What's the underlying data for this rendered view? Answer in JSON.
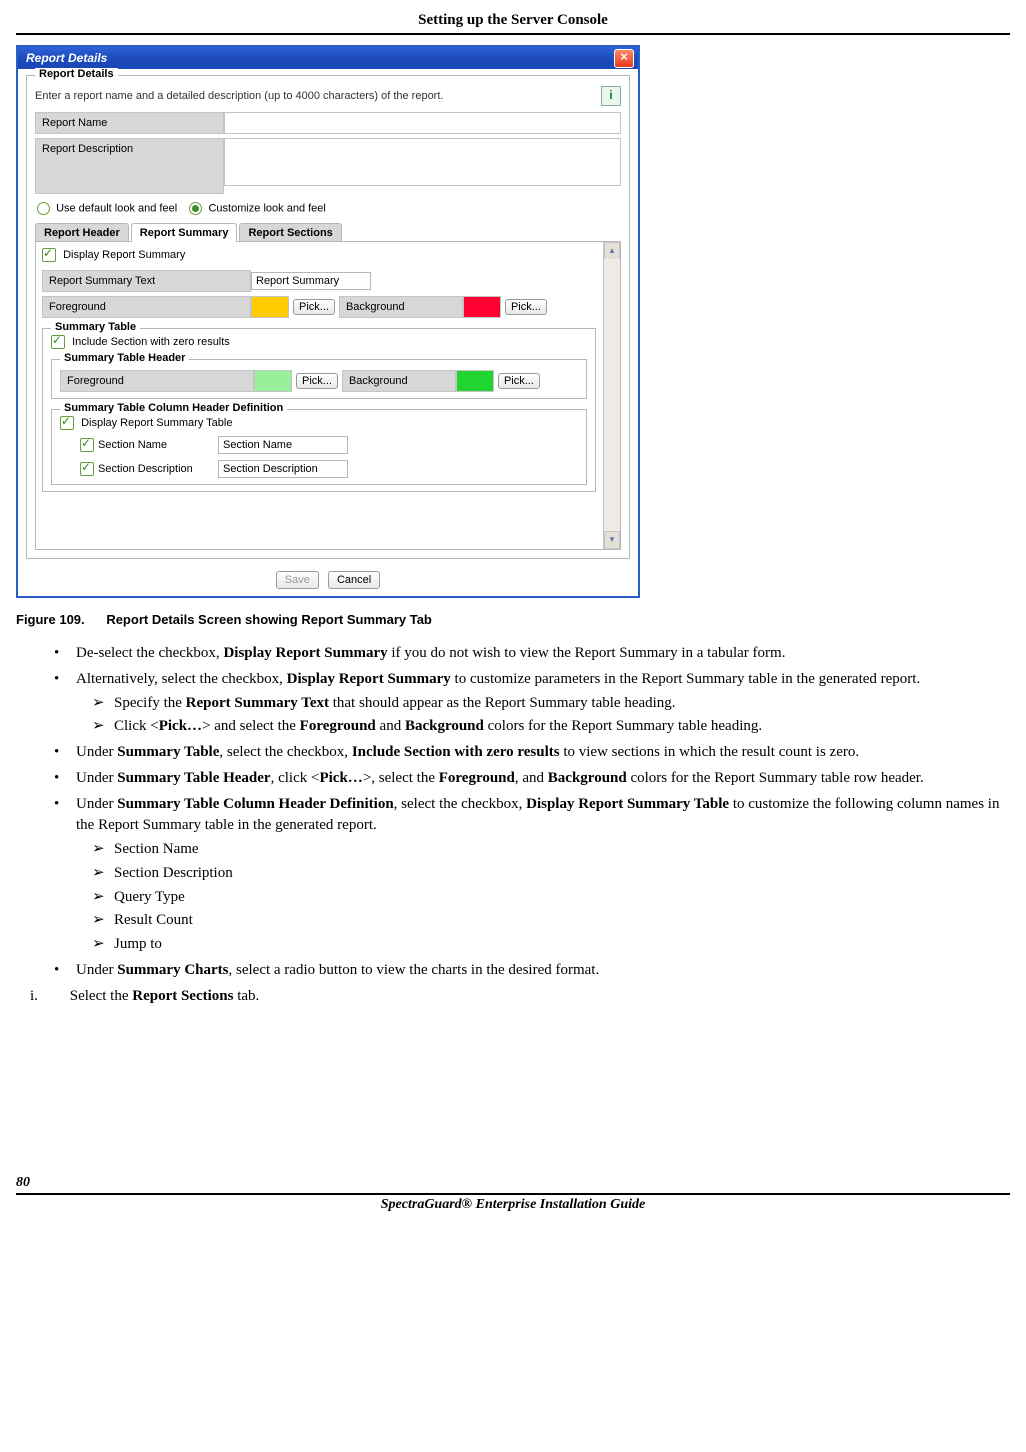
{
  "header": {
    "title": "Setting up the Server Console"
  },
  "dialog": {
    "title": "Report Details",
    "details_section_title": "Report Details",
    "hint": "Enter a report name and a detailed description (up to 4000 characters) of the report.",
    "report_name_label": "Report Name",
    "report_description_label": "Report Description",
    "radio_default": "Use default look and feel",
    "radio_custom": "Customize look and feel",
    "tabs": [
      "Report Header",
      "Report Summary",
      "Report Sections"
    ],
    "display_summary_label": "Display Report Summary",
    "summary_text_label": "Report Summary Text",
    "summary_text_value": "Report Summary",
    "foreground_label": "Foreground",
    "background_label": "Background",
    "pick_btn": "Pick...",
    "summary_table_title": "Summary Table",
    "include_zero_label": "Include Section with zero results",
    "summary_header_title": "Summary Table Header",
    "colhdr_def_title": "Summary Table Column Header Definition",
    "display_summary_table_label": "Display Report Summary Table",
    "section_name_label": "Section Name",
    "section_name_value": "Section Name",
    "section_desc_label": "Section Description",
    "section_desc_value": "Section Description",
    "save_btn": "Save",
    "cancel_btn": "Cancel",
    "colors": {
      "fg1": "#ffcc00",
      "bg1": "#ff0033",
      "fg2": "#9af09a",
      "bg2": "#22d42f"
    }
  },
  "figure": {
    "number": "Figure  109.",
    "caption": "Report Details Screen showing Report Summary Tab"
  },
  "doc": {
    "li1a": "De-select the checkbox, ",
    "li1b": "Display Report Summary",
    "li1c": " if you do not wish to view the Report Summary in a tabular form.",
    "li2a": "Alternatively, select the checkbox, ",
    "li2b": "Display Report Summary",
    "li2c": " to customize parameters in the Report Summary table in the generated report.",
    "li2_s1a": "Specify the ",
    "li2_s1b": "Report Summary Text",
    "li2_s1c": " that should appear as the Report Summary table heading.",
    "li2_s2a": "Click <",
    "li2_s2b": "Pick…",
    "li2_s2c": "> and select the ",
    "li2_s2d": "Foreground",
    "li2_s2e": " and ",
    "li2_s2f": "Background",
    "li2_s2g": " colors for the Report Summary table heading.",
    "li3a": "Under ",
    "li3b": "Summary Table",
    "li3c": ", select the checkbox, ",
    "li3d": "Include Section with zero results",
    "li3e": " to view sections in which the result count is zero.",
    "li4a": "Under ",
    "li4b": "Summary Table Header",
    "li4c": ", click <",
    "li4d": "Pick…",
    "li4e": ">, select the ",
    "li4f": "Foreground",
    "li4g": ", and ",
    "li4h": "Background",
    "li4i": " colors for the Report Summary table row header.",
    "li5a": "Under ",
    "li5b": "Summary Table Column Header Definition",
    "li5c": ", select the checkbox, ",
    "li5d": "Display Report Summary Table",
    "li5e": " to customize the following column names in the Report Summary table in the generated report.",
    "li5_items": [
      "Section Name",
      "Section Description",
      "Query Type",
      "Result Count",
      "Jump to"
    ],
    "li6a": "Under ",
    "li6b": "Summary Charts",
    "li6c": ", select a radio button to view the charts in the desired format.",
    "step_i_num": "i.",
    "step_i_a": "Select the ",
    "step_i_b": "Report Sections",
    "step_i_c": " tab."
  },
  "footer": {
    "page_number": "80",
    "title": "SpectraGuard® Enterprise Installation Guide"
  }
}
